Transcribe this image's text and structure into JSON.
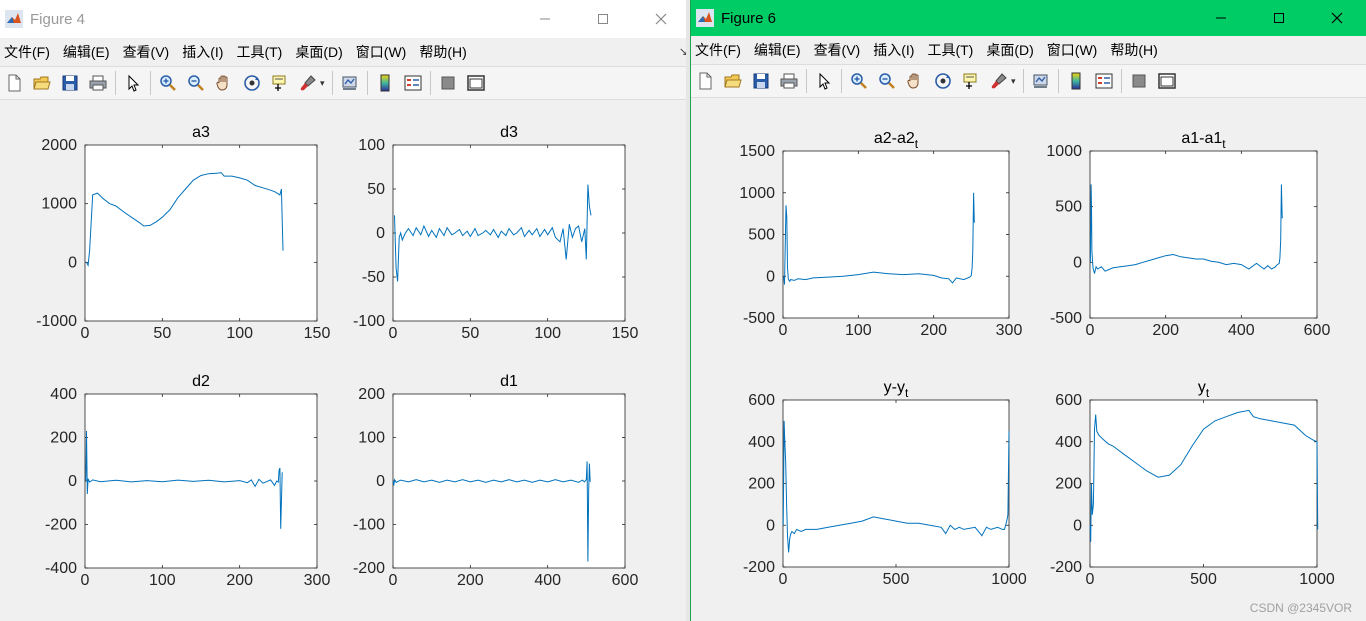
{
  "windows": [
    {
      "id": "win4",
      "title": "Figure 4",
      "active": false,
      "menu": [
        "文件(F)",
        "编辑(E)",
        "查看(V)",
        "插入(I)",
        "工具(T)",
        "桌面(D)",
        "窗口(W)",
        "帮助(H)"
      ],
      "menu_overflow": "↘",
      "toolbar": [
        "new-figure-icon",
        "open-icon",
        "save-icon",
        "print-icon",
        "|",
        "pointer-icon",
        "|",
        "zoom-in-icon",
        "zoom-out-icon",
        "pan-icon",
        "rotate-3d-icon",
        "data-cursor-icon",
        "brush-icon",
        "brush-dropdown",
        "|",
        "link-plot-icon",
        "|",
        "colorbar-icon",
        "legend-icon",
        "|",
        "hide-plot-tools-icon",
        "show-plot-tools-icon"
      ]
    },
    {
      "id": "win6",
      "title": "Figure 6",
      "active": true,
      "menu": [
        "文件(F)",
        "编辑(E)",
        "查看(V)",
        "插入(I)",
        "工具(T)",
        "桌面(D)",
        "窗口(W)",
        "帮助(H)"
      ],
      "toolbar": [
        "new-figure-icon",
        "open-icon",
        "save-icon",
        "print-icon",
        "|",
        "pointer-icon",
        "|",
        "zoom-in-icon",
        "zoom-out-icon",
        "pan-icon",
        "rotate-3d-icon",
        "data-cursor-icon",
        "brush-icon",
        "brush-dropdown",
        "|",
        "link-plot-icon",
        "|",
        "colorbar-icon",
        "legend-icon",
        "|",
        "hide-plot-tools-icon",
        "show-plot-tools-icon"
      ]
    }
  ],
  "colors": {
    "line": "#0072bd",
    "active_title": "#00cc66",
    "inactive_title_text": "#999999"
  },
  "watermark": "CSDN @2345VOR",
  "chart_data": [
    {
      "figure": "Figure 4",
      "type": "line",
      "title": "a3",
      "title_sub": "",
      "xlim": [
        0,
        150
      ],
      "ylim": [
        -1000,
        2000
      ],
      "xticks": [
        0,
        50,
        100,
        150
      ],
      "yticks": [
        -1000,
        0,
        1000,
        2000
      ],
      "series": [
        {
          "x": [
            1,
            2,
            3,
            5,
            8,
            12,
            16,
            20,
            25,
            30,
            35,
            38,
            42,
            46,
            50,
            55,
            60,
            65,
            70,
            75,
            80,
            85,
            88,
            90,
            95,
            100,
            105,
            110,
            115,
            120,
            123,
            126,
            127,
            128
          ],
          "y": [
            0,
            -50,
            200,
            1150,
            1180,
            1080,
            1000,
            960,
            860,
            770,
            680,
            620,
            630,
            690,
            770,
            900,
            1100,
            1250,
            1400,
            1480,
            1510,
            1520,
            1530,
            1470,
            1470,
            1440,
            1400,
            1310,
            1270,
            1230,
            1200,
            1150,
            1250,
            200
          ]
        }
      ]
    },
    {
      "figure": "Figure 4",
      "type": "line",
      "title": "d3",
      "title_sub": "",
      "xlim": [
        0,
        150
      ],
      "ylim": [
        -100,
        100
      ],
      "xticks": [
        0,
        50,
        100,
        150
      ],
      "yticks": [
        -100,
        -50,
        0,
        50,
        100
      ],
      "series": [
        {
          "x": [
            1,
            2,
            3,
            4,
            5,
            6,
            8,
            10,
            13,
            15,
            18,
            20,
            23,
            25,
            28,
            30,
            33,
            35,
            38,
            40,
            43,
            45,
            48,
            50,
            53,
            55,
            58,
            60,
            63,
            65,
            68,
            70,
            73,
            75,
            78,
            80,
            83,
            85,
            88,
            90,
            93,
            95,
            98,
            100,
            103,
            105,
            108,
            110,
            112,
            114,
            116,
            118,
            120,
            122,
            124,
            125,
            126,
            127,
            128
          ],
          "y": [
            20,
            -40,
            -55,
            -5,
            0,
            -8,
            0,
            5,
            -3,
            6,
            -2,
            8,
            -4,
            3,
            -5,
            5,
            -3,
            6,
            -2,
            0,
            4,
            -3,
            2,
            -4,
            5,
            -3,
            0,
            3,
            -2,
            4,
            -5,
            2,
            -3,
            5,
            -2,
            0,
            6,
            -4,
            3,
            -2,
            5,
            -4,
            4,
            -2,
            6,
            -5,
            -10,
            5,
            -30,
            10,
            -5,
            5,
            8,
            -10,
            5,
            -30,
            55,
            30,
            20
          ]
        }
      ]
    },
    {
      "figure": "Figure 4",
      "type": "line",
      "title": "d2",
      "title_sub": "",
      "xlim": [
        0,
        300
      ],
      "ylim": [
        -400,
        400
      ],
      "xticks": [
        0,
        100,
        200,
        300
      ],
      "yticks": [
        -400,
        -200,
        0,
        200,
        400
      ],
      "series": [
        {
          "x": [
            1,
            2,
            3,
            4,
            6,
            10,
            20,
            40,
            60,
            80,
            100,
            120,
            140,
            160,
            180,
            200,
            210,
            215,
            220,
            225,
            230,
            240,
            245,
            248,
            250,
            251,
            252,
            253,
            254,
            255
          ],
          "y": [
            0,
            230,
            -60,
            10,
            -5,
            5,
            -3,
            3,
            -4,
            2,
            -3,
            4,
            -2,
            3,
            -4,
            2,
            -8,
            5,
            -25,
            8,
            -10,
            5,
            -20,
            0,
            -5,
            50,
            60,
            -220,
            -100,
            40
          ]
        }
      ]
    },
    {
      "figure": "Figure 4",
      "type": "line",
      "title": "d1",
      "title_sub": "",
      "xlim": [
        0,
        600
      ],
      "ylim": [
        -200,
        200
      ],
      "xticks": [
        0,
        200,
        400,
        600
      ],
      "yticks": [
        -200,
        -100,
        0,
        100,
        200
      ],
      "series": [
        {
          "x": [
            1,
            2,
            4,
            8,
            20,
            40,
            60,
            80,
            100,
            120,
            140,
            160,
            180,
            200,
            220,
            240,
            260,
            280,
            300,
            320,
            340,
            360,
            380,
            400,
            420,
            440,
            460,
            480,
            490,
            495,
            500,
            502,
            504,
            506,
            508,
            510
          ],
          "y": [
            0,
            -10,
            3,
            -3,
            2,
            -2,
            3,
            -2,
            2,
            -3,
            2,
            -2,
            3,
            -2,
            2,
            -3,
            2,
            -2,
            3,
            -2,
            2,
            -3,
            2,
            -2,
            3,
            -2,
            2,
            -3,
            2,
            -2,
            3,
            45,
            -185,
            -20,
            40,
            -2
          ]
        }
      ]
    },
    {
      "figure": "Figure 6",
      "type": "line",
      "title": "a2-a2",
      "title_sub": "t",
      "xlim": [
        0,
        300
      ],
      "ylim": [
        -500,
        1500
      ],
      "xticks": [
        0,
        100,
        200,
        300
      ],
      "yticks": [
        -500,
        0,
        500,
        1000,
        1500
      ],
      "series": [
        {
          "x": [
            1,
            2,
            3,
            4,
            5,
            6,
            7,
            8,
            9,
            10,
            15,
            20,
            30,
            40,
            60,
            80,
            100,
            120,
            140,
            160,
            180,
            200,
            210,
            220,
            225,
            230,
            240,
            248,
            250,
            251,
            252,
            253,
            254,
            255
          ],
          "y": [
            0,
            -100,
            400,
            850,
            700,
            100,
            -30,
            -50,
            -60,
            -40,
            -50,
            -30,
            -40,
            -20,
            -10,
            0,
            20,
            50,
            30,
            20,
            30,
            10,
            -20,
            -30,
            -80,
            -20,
            -40,
            -10,
            10,
            100,
            300,
            1000,
            650,
            650
          ]
        }
      ]
    },
    {
      "figure": "Figure 6",
      "type": "line",
      "title": "a1-a1",
      "title_sub": "t",
      "xlim": [
        0,
        600
      ],
      "ylim": [
        -500,
        1000
      ],
      "xticks": [
        0,
        200,
        400,
        600
      ],
      "yticks": [
        -500,
        0,
        500,
        1000
      ],
      "series": [
        {
          "x": [
            1,
            2,
            3,
            4,
            5,
            8,
            12,
            16,
            20,
            30,
            40,
            60,
            80,
            100,
            120,
            140,
            160,
            180,
            200,
            220,
            240,
            260,
            280,
            300,
            320,
            340,
            360,
            380,
            400,
            420,
            440,
            460,
            470,
            480,
            490,
            495,
            500,
            502,
            504,
            506,
            508,
            510
          ],
          "y": [
            0,
            400,
            700,
            500,
            100,
            -50,
            -100,
            -40,
            -60,
            -40,
            -80,
            -50,
            -40,
            -30,
            -20,
            0,
            20,
            40,
            60,
            70,
            50,
            40,
            30,
            30,
            10,
            0,
            -20,
            -10,
            -20,
            -60,
            -10,
            -60,
            -30,
            -60,
            -40,
            -20,
            -10,
            40,
            200,
            700,
            400,
            400
          ]
        }
      ]
    },
    {
      "figure": "Figure 6",
      "type": "line",
      "title": "y-y",
      "title_sub": "t",
      "xlim": [
        0,
        1000
      ],
      "ylim": [
        -200,
        600
      ],
      "xticks": [
        0,
        500,
        1000
      ],
      "yticks": [
        -200,
        0,
        200,
        400,
        600
      ],
      "series": [
        {
          "x": [
            1,
            3,
            5,
            8,
            12,
            16,
            20,
            25,
            30,
            35,
            40,
            50,
            60,
            80,
            100,
            150,
            200,
            250,
            300,
            350,
            400,
            450,
            500,
            550,
            600,
            650,
            700,
            720,
            740,
            760,
            780,
            800,
            850,
            880,
            900,
            920,
            950,
            970,
            980,
            990,
            995,
            1000
          ],
          "y": [
            0,
            250,
            500,
            400,
            300,
            100,
            -50,
            -130,
            -60,
            -40,
            -30,
            -40,
            -20,
            -30,
            -20,
            -20,
            -10,
            0,
            10,
            20,
            40,
            30,
            20,
            10,
            10,
            0,
            -10,
            -40,
            0,
            -20,
            -10,
            -20,
            -10,
            -50,
            -10,
            -20,
            -10,
            -20,
            -20,
            20,
            50,
            450
          ]
        }
      ]
    },
    {
      "figure": "Figure 6",
      "type": "line",
      "title": "y",
      "title_sub": "t",
      "xlim": [
        0,
        1000
      ],
      "ylim": [
        -200,
        600
      ],
      "xticks": [
        0,
        500,
        1000
      ],
      "yticks": [
        -200,
        0,
        200,
        400,
        600
      ],
      "series": [
        {
          "x": [
            1,
            3,
            6,
            10,
            15,
            20,
            25,
            30,
            40,
            60,
            80,
            100,
            150,
            200,
            250,
            300,
            350,
            400,
            450,
            500,
            550,
            600,
            650,
            700,
            720,
            750,
            800,
            850,
            900,
            950,
            980,
            1000,
            1003
          ],
          "y": [
            0,
            -80,
            200,
            50,
            100,
            460,
            530,
            450,
            430,
            410,
            390,
            380,
            340,
            300,
            260,
            230,
            240,
            290,
            380,
            460,
            500,
            520,
            540,
            550,
            520,
            510,
            500,
            490,
            480,
            430,
            410,
            400,
            -20
          ]
        }
      ]
    }
  ]
}
